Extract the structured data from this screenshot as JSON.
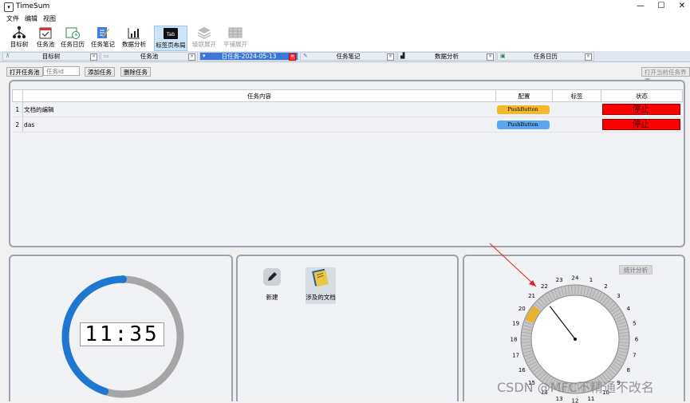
{
  "app": {
    "title": "TimeSum"
  },
  "menu": [
    "文件",
    "编辑",
    "视图"
  ],
  "toolbar": [
    {
      "label": "目标树",
      "icon": "tree-icon"
    },
    {
      "label": "任务池",
      "icon": "calendar-icon"
    },
    {
      "label": "任务日历",
      "icon": "calendar-clock-icon"
    },
    {
      "label": "任务笔记",
      "icon": "note-pen-icon"
    },
    {
      "label": "数据分析",
      "icon": "chart-icon"
    },
    {
      "label": "标签页布局",
      "icon": "tab-layout-icon"
    },
    {
      "label": "级联展开",
      "icon": "layers-icon"
    },
    {
      "label": "平铺展开",
      "icon": "grid-icon"
    }
  ],
  "tabs": [
    {
      "label": "目标树"
    },
    {
      "label": "任务池"
    },
    {
      "label": "日任务-2024-05-13"
    },
    {
      "label": "任务笔记"
    },
    {
      "label": "数据分析"
    },
    {
      "label": "任务日历"
    }
  ],
  "task_toolbar": {
    "open_pool": "打开任务池",
    "task_id_placeholder": "任务id",
    "add_task": "添加任务",
    "delete_task": "删除任务",
    "open_current": "打开当前任务界面"
  },
  "table": {
    "headers": [
      "任务内容",
      "配置",
      "标签",
      "状态"
    ],
    "rows": [
      {
        "num": "1",
        "content": "文档的编辑",
        "config": "PushButton",
        "config_color": "#f5b829",
        "tag": "",
        "status": "停止"
      },
      {
        "num": "2",
        "content": "das",
        "config": "PushButton",
        "config_color": "#5aa7ee",
        "tag": "",
        "status": "停止"
      }
    ]
  },
  "timer": {
    "display": "11:35",
    "progress": 0.45
  },
  "actions": [
    {
      "label": "新建",
      "icon": "edit-icon"
    },
    {
      "label": "涉及的文档",
      "icon": "book-icon"
    }
  ],
  "stats": {
    "button": "统计分析"
  },
  "dial": {
    "hours": [
      "24",
      "1",
      "2",
      "3",
      "4",
      "5",
      "6",
      "7",
      "8",
      "9",
      "10",
      "11",
      "12",
      "13",
      "14",
      "15",
      "16",
      "17",
      "18",
      "19",
      "20",
      "21",
      "22",
      "23"
    ],
    "hand_hour": 21.5,
    "highlight_hours": [
      20.3,
      19.7
    ]
  },
  "watermark": "CSDN @MFC不精通不改名"
}
